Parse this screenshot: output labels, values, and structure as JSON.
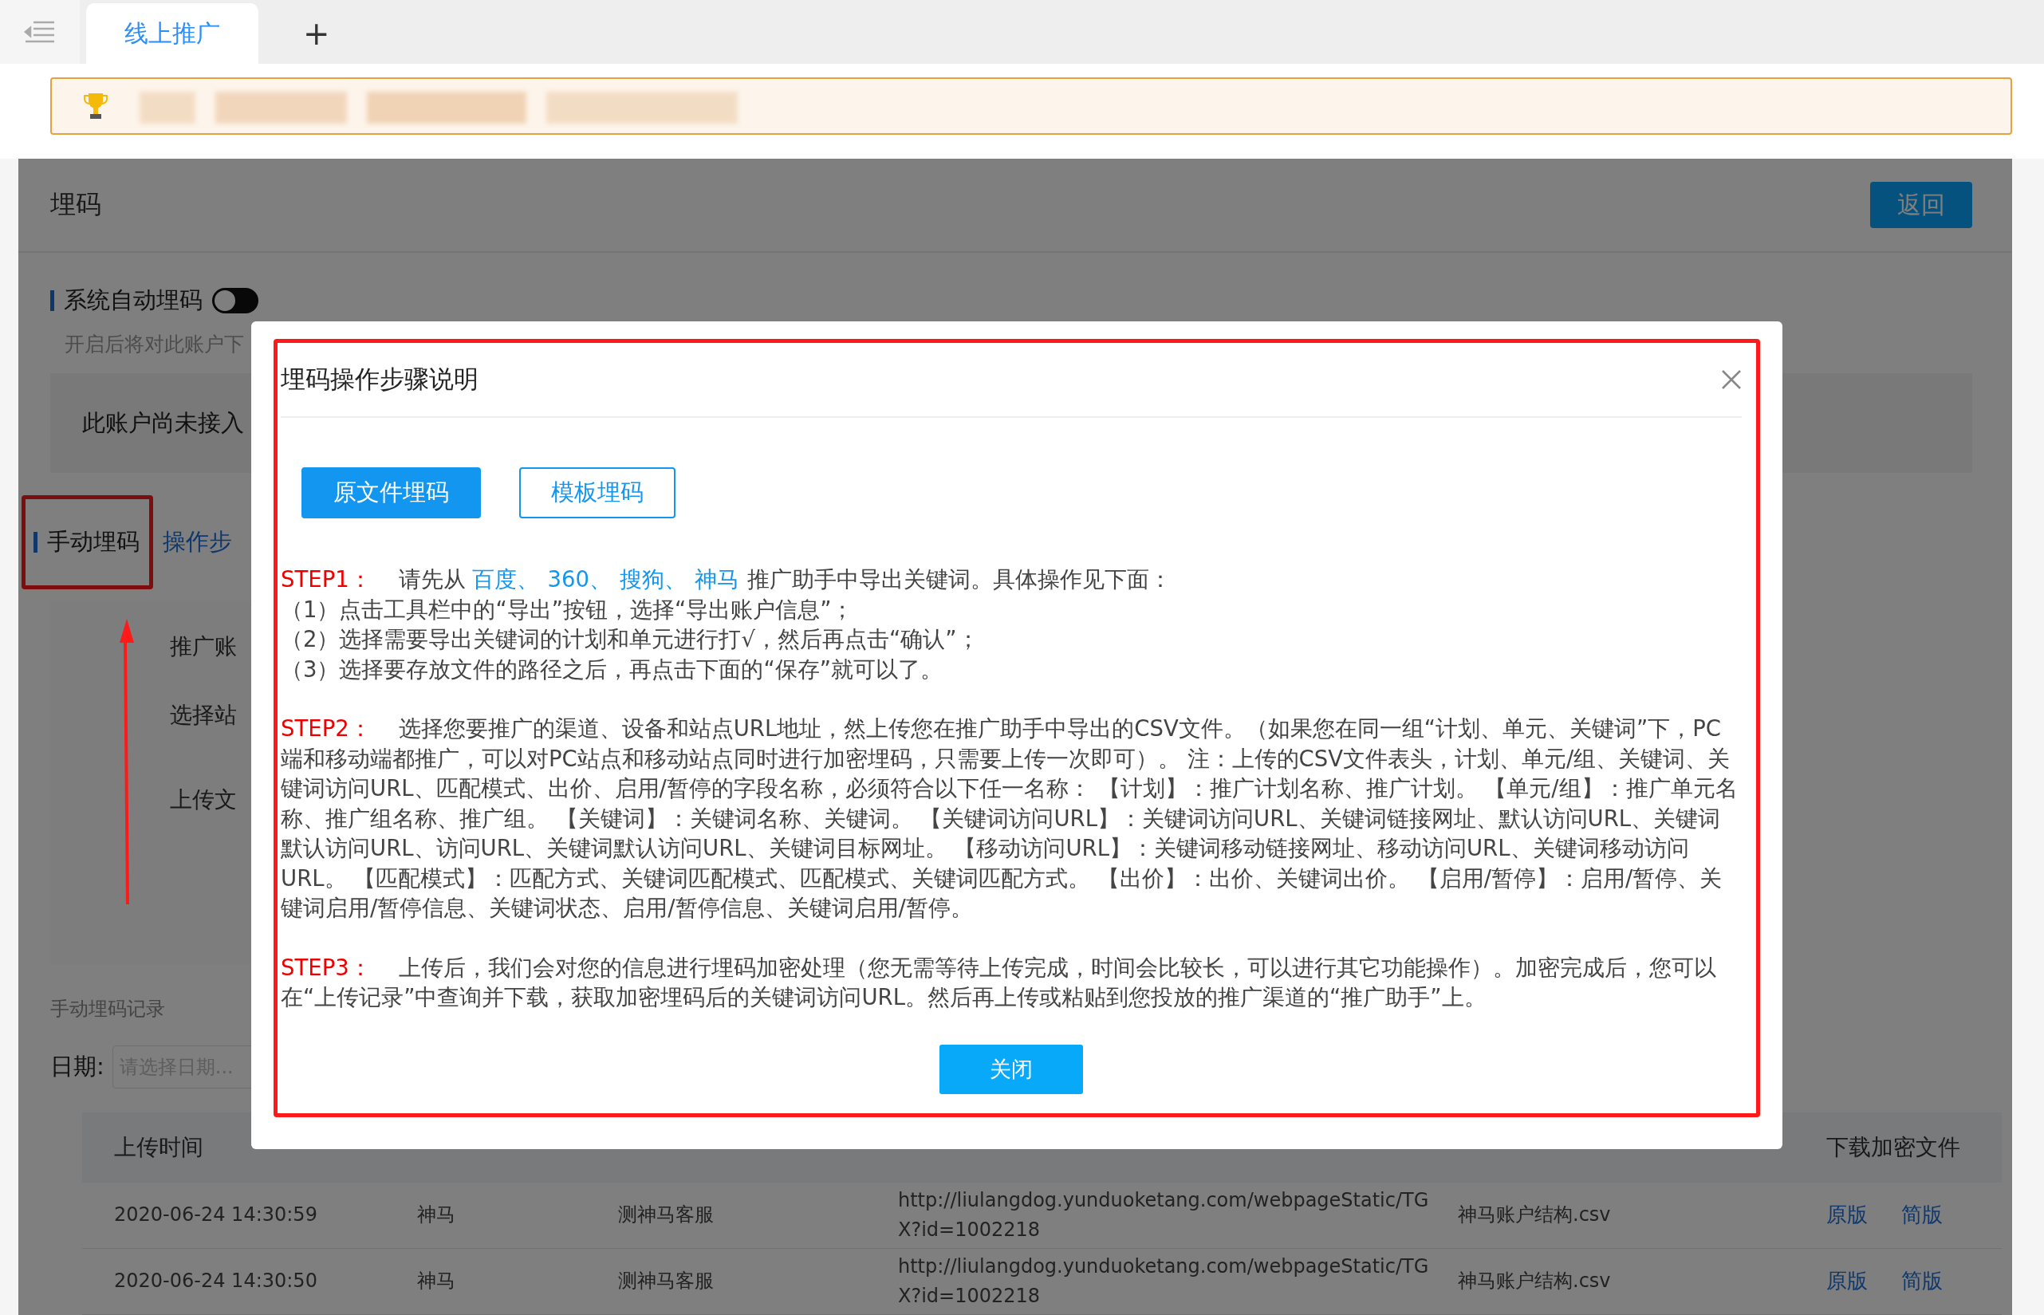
{
  "tab_bar": {
    "tabs": [
      {
        "label": "线上推广",
        "selected": true
      }
    ],
    "add_label": "+"
  },
  "page": {
    "title": "埋码",
    "back_button": "返回",
    "auto": {
      "label": "系统自动埋码",
      "on": false,
      "hint": "开启后将对此账户下"
    },
    "notice_box": "此账户尚未接入",
    "manual": {
      "label": "手动埋码",
      "link": "操作步"
    },
    "form_labels": [
      "推广账",
      "选择站",
      "上传文"
    ],
    "records_title": "手动埋码记录",
    "date_filter": {
      "label": "日期:",
      "placeholder": "请选择日期..."
    },
    "table": {
      "columns": [
        "上传时间",
        "下载加密文件"
      ],
      "rows": [
        {
          "time": "2020-06-24 14:30:59",
          "channel": "神马",
          "account": "测神马客服",
          "url": "http://liulangdog.yunduoketang.com/webpageStatic/TGX?id=1002218",
          "file": "神马账户结构.csv",
          "links": [
            "原版",
            "简版"
          ]
        },
        {
          "time": "2020-06-24 14:30:50",
          "channel": "神马",
          "account": "测神马客服",
          "url": "http://liulangdog.yunduoketang.com/webpageStatic/TGX?id=1002218",
          "file": "神马账户结构.csv",
          "links": [
            "原版",
            "简版"
          ]
        }
      ]
    }
  },
  "dialog": {
    "title": "埋码操作步骤说明",
    "tabs": [
      {
        "label": "原文件埋码",
        "selected": true
      },
      {
        "label": "模板埋码",
        "selected": false
      }
    ],
    "steps": [
      {
        "label": "STEP1：",
        "text": "请先从",
        "links": [
          "百度、",
          "360、",
          "搜狗、",
          "神马"
        ],
        "after": "推广助手中导出关键词。具体操作见下面：",
        "lines": [
          "（1）点击工具栏中的“导出”按钮，选择“导出账户信息”；",
          "（2）选择需要导出关键词的计划和单元进行打√，然后再点击“确认”；",
          "（3）选择要存放文件的路径之后，再点击下面的“保存”就可以了。"
        ]
      },
      {
        "label": "STEP2：",
        "text": "选择您要推广的渠道、设备和站点URL地址，然上传您在推广助手中导出的CSV文件。（如果您在同一组“计划、单元、关键词”下，PC端和移动端都推广，可以对PC站点和移动站点同时进行加密埋码，只需要上传一次即可）。 注：上传的CSV文件表头，计划、单元/组、关键词、关键词访问URL、匹配模式、出价、启用/暂停的字段名称，必须符合以下任一名称： 【计划】：推广计划名称、推广计划。 【单元/组】：推广单元名称、推广组名称、推广组。 【关键词】：关键词名称、关键词。 【关键词访问URL】：关键词访问URL、关键词链接网址、默认访问URL、关键词默认访问URL、访问URL、关键词默认访问URL、关键词目标网址。 【移动访问URL】：关键词移动链接网址、移动访问URL、关键词移动访问URL。 【匹配模式】：匹配方式、关键词匹配模式、匹配模式、关键词匹配方式。 【出价】：出价、关键词出价。 【启用/暂停】：启用/暂停、关键词启用/暂停信息、关键词状态、启用/暂停信息、关键词启用/暂停。"
      },
      {
        "label": "STEP3：",
        "text": "上传后，我们会对您的信息进行埋码加密处理（您无需等待上传完成，时间会比较长，可以进行其它功能操作）。加密完成后，您可以在“上传记录”中查询并下载，获取加密埋码后的关键词访问URL。然后再上传或粘贴到您投放的推广渠道的“推广助手”上。"
      }
    ],
    "close_button": "关闭"
  }
}
